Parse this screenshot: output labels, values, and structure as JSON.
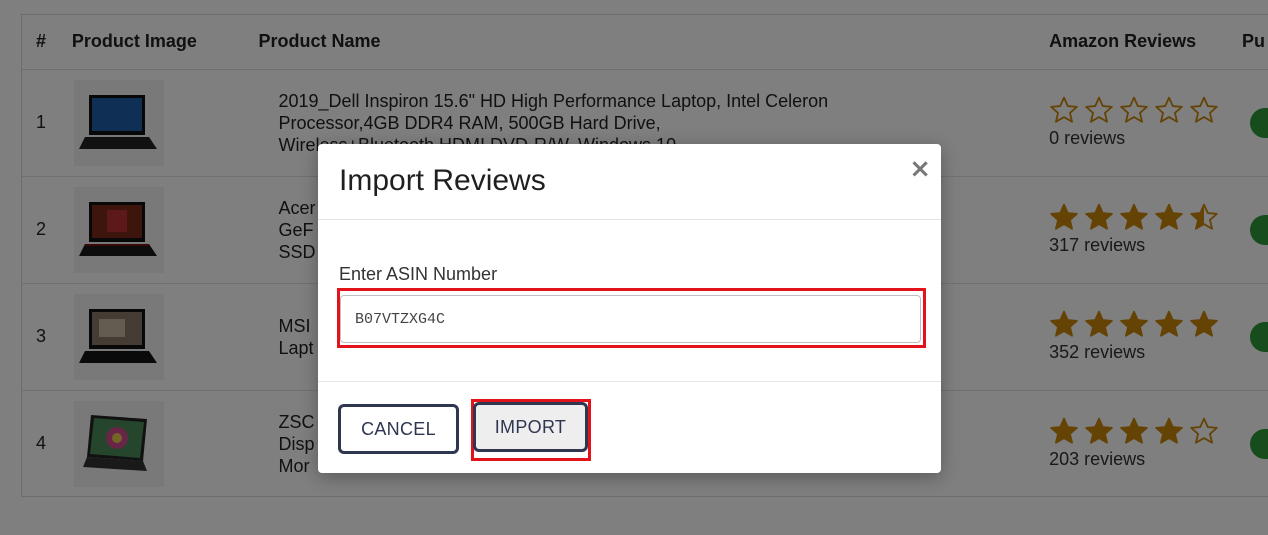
{
  "table": {
    "headers": [
      "#",
      "Product Image",
      "Product Name",
      "Amazon Reviews",
      "Pu"
    ],
    "rows": [
      {
        "num": "1",
        "name_lines": [
          "2019_Dell Inspiron 15.6\" HD High Performance Laptop, Intel Celeron",
          "Processor,4GB DDR4 RAM, 500GB Hard Drive,",
          "Wireless+Bluetooth,HDMI,DVD-R/W, Windows 10"
        ],
        "rating": 0,
        "reviews": "0 reviews",
        "image": "laptop-dell-image"
      },
      {
        "num": "2",
        "name_lines": [
          "Acer",
          "GeF",
          "SSD"
        ],
        "rating": 4.5,
        "reviews": "317 reviews",
        "image": "laptop-acer-image"
      },
      {
        "num": "3",
        "name_lines": [
          "MSI",
          "Lapt"
        ],
        "rating": 5,
        "reviews": "352 reviews",
        "image": "laptop-msi-image"
      },
      {
        "num": "4",
        "name_lines": [
          "ZSC",
          "Disp",
          "Mor"
        ],
        "rating": 4,
        "reviews": "203 reviews",
        "image": "portable-monitor-image"
      }
    ]
  },
  "colors": {
    "star": "#c8860a",
    "publish": "#2e9a3a",
    "highlight": "#e3131b",
    "button_border": "#2e3650"
  },
  "modal": {
    "title": "Import Reviews",
    "close_label": "×",
    "field_label": "Enter ASIN Number",
    "asin_value": "B07VTZXG4C",
    "cancel_label": "CANCEL",
    "import_label": "IMPORT"
  }
}
